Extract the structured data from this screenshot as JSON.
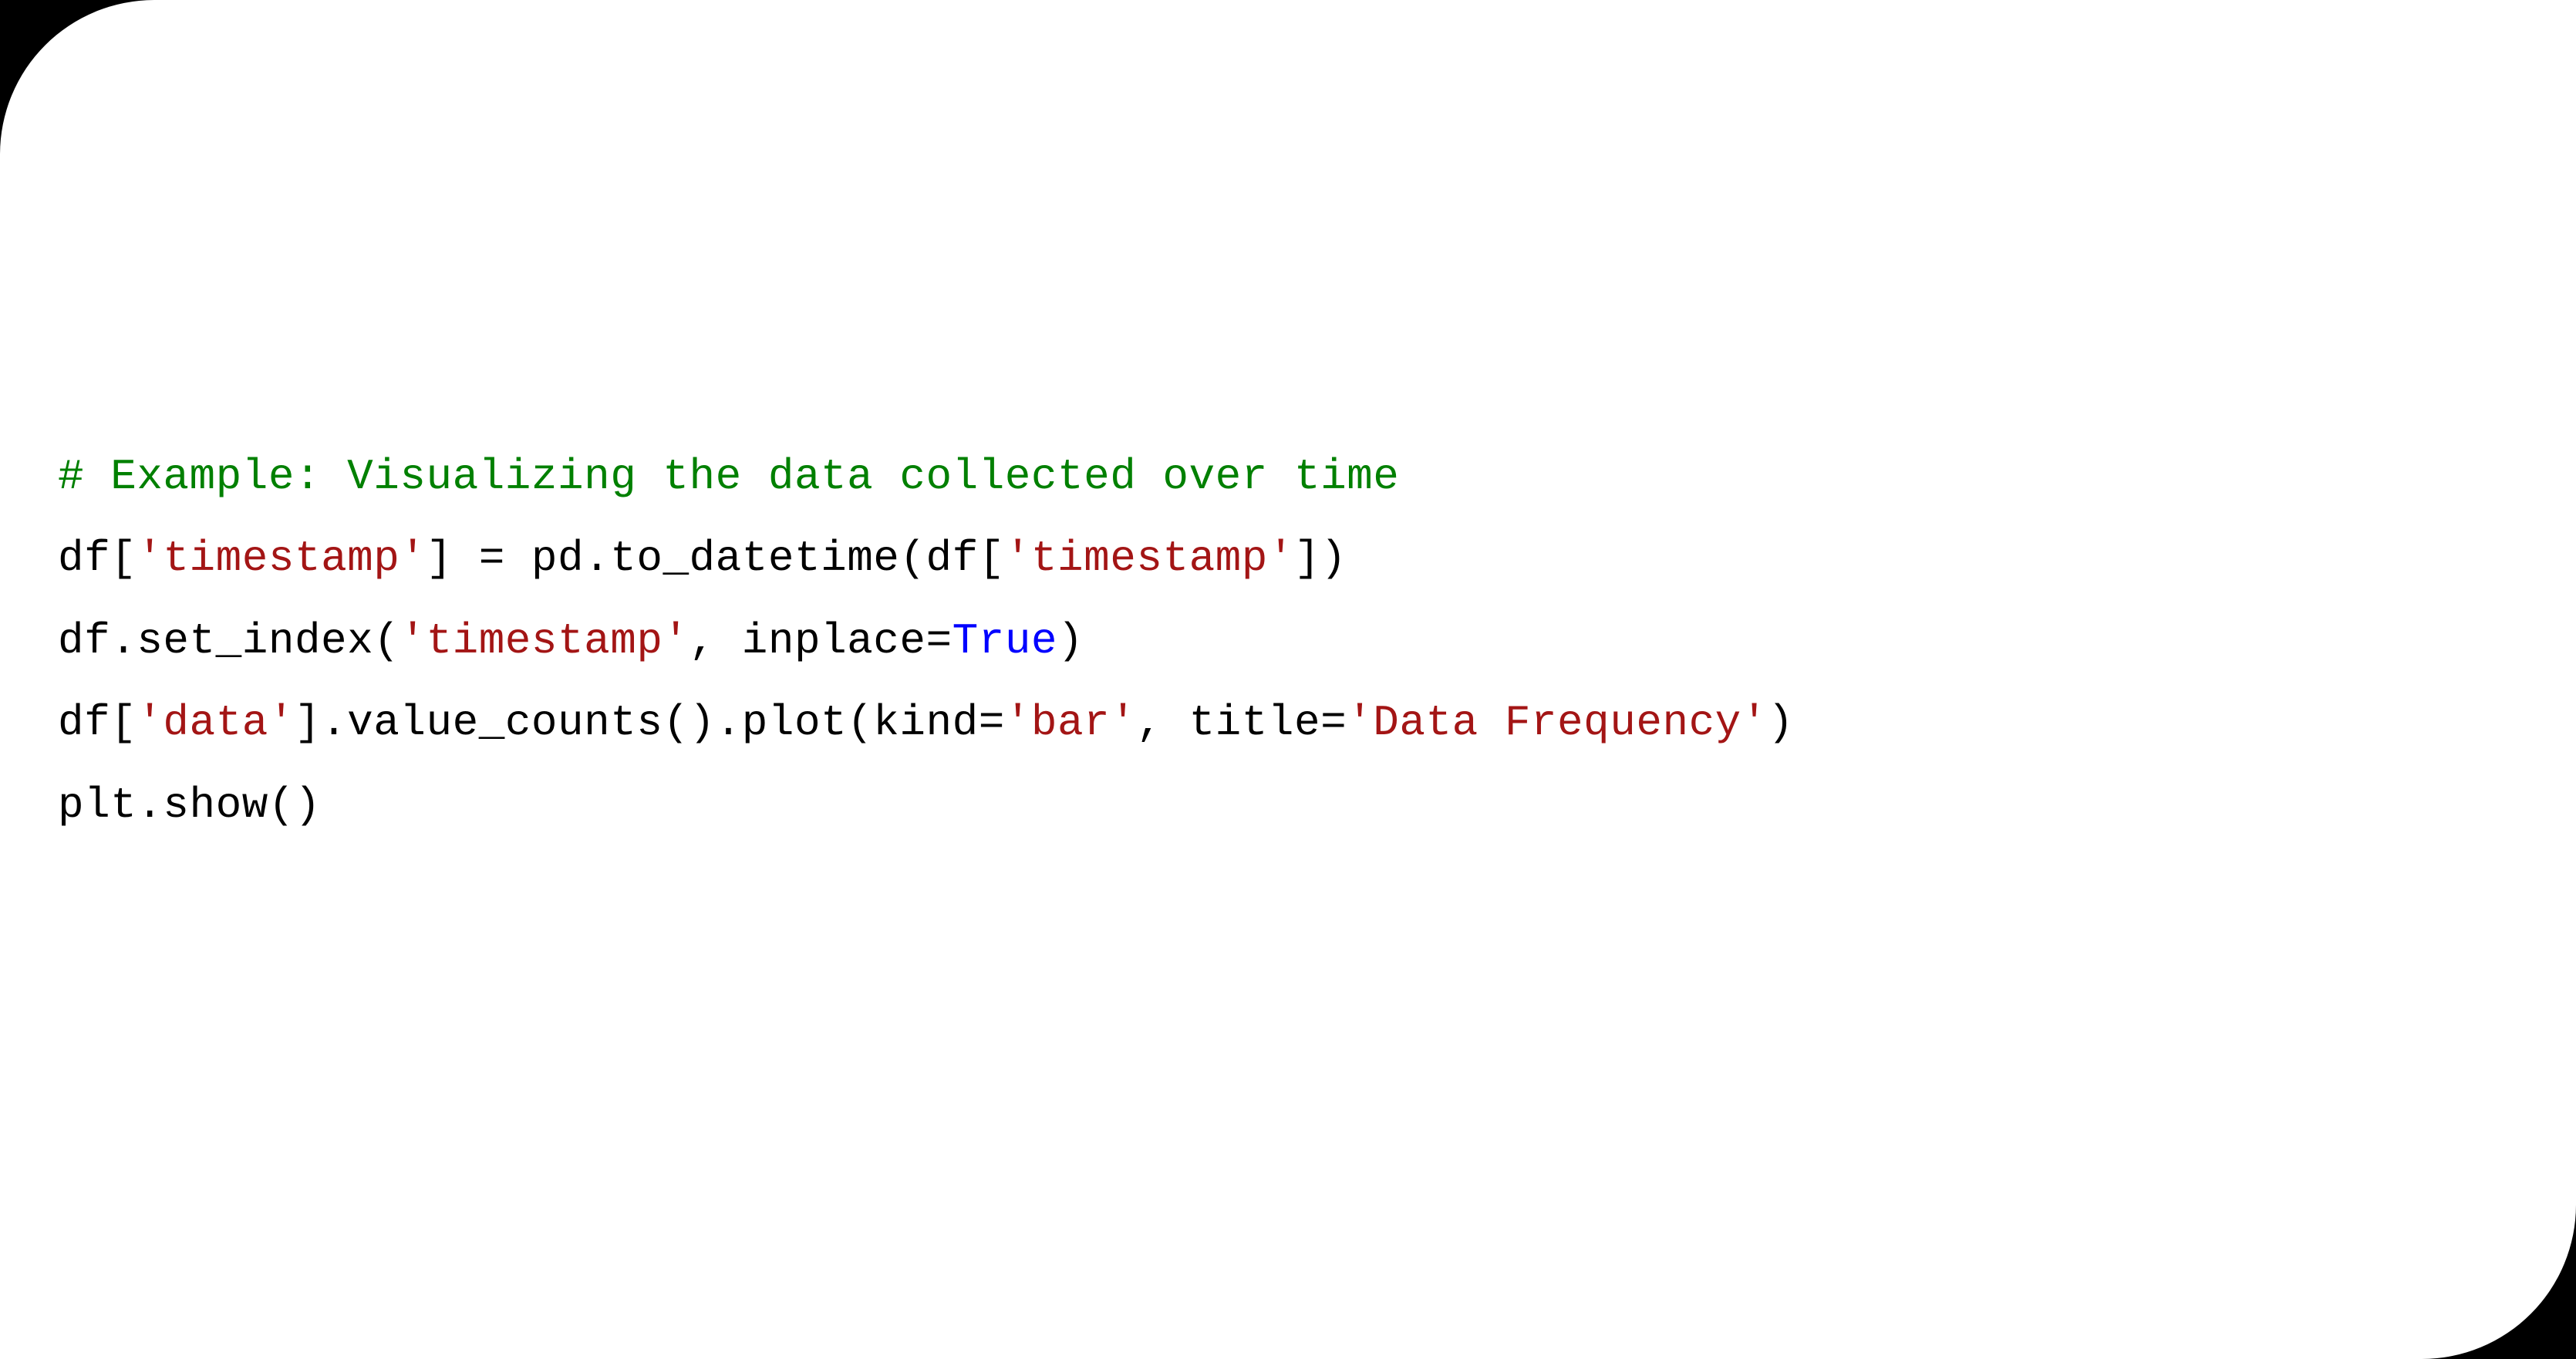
{
  "code": {
    "line1": {
      "comment": "# Example: Visualizing the data collected over time"
    },
    "line2": {
      "p1": "df[",
      "s1": "'timestamp'",
      "p2": "] = pd.to_datetime(df[",
      "s2": "'timestamp'",
      "p3": "])"
    },
    "line3": {
      "p1": "df.set_index(",
      "s1": "'timestamp'",
      "p2": ", inplace=",
      "kw1": "True",
      "p3": ")"
    },
    "line4": {
      "p1": "df[",
      "s1": "'data'",
      "p2": "].value_counts().plot(kind=",
      "s2": "'bar'",
      "p3": ", title=",
      "s3": "'Data Frequency'",
      "p4": ")"
    },
    "line5": {
      "p1": "plt.show()"
    }
  }
}
